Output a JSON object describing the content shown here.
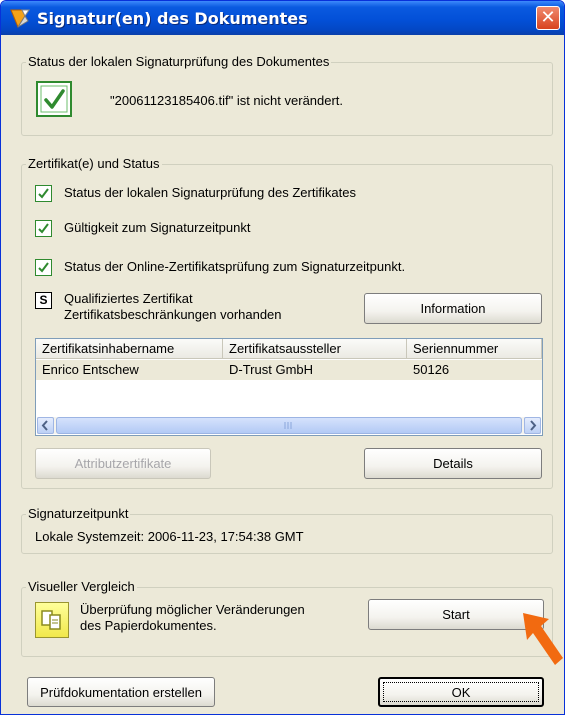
{
  "window": {
    "title": "Signatur(en) des Dokumentes",
    "close_glyph": "✕"
  },
  "doc_status": {
    "legend": "Status der lokalen Signaturprüfung des Dokumentes",
    "message": "\"20061123185406.tif\" ist nicht verändert.",
    "icon": "check-icon",
    "status_color": "#2f8a2f"
  },
  "cert": {
    "legend": "Zertifikat(e) und Status",
    "checks": [
      "Status der lokalen Signaturprüfung des Zertifikates",
      "Gültigkeit zum Signaturzeitpunkt",
      "Status der Online-Zertifikatsprüfung zum Signaturzeitpunkt."
    ],
    "qualified_badge": "S",
    "qualified_line1": "Qualifiziertes Zertifikat",
    "qualified_line2": "Zertifikatsbeschränkungen vorhanden",
    "info_button": "Information",
    "table": {
      "columns": [
        "Zertifikatsinhabername",
        "Zertifikatsaussteller",
        "Seriennummer"
      ],
      "rows": [
        [
          "Enrico Entschew",
          "D-Trust GmbH",
          "50126"
        ]
      ]
    },
    "attr_button": "Attributzertifikate",
    "details_button": "Details"
  },
  "sig_time": {
    "legend": "Signaturzeitpunkt",
    "text": "Lokale Systemzeit: 2006-11-23, 17:54:38 GMT"
  },
  "visual": {
    "legend": "Visueller Vergleich",
    "line1": "Überprüfung möglicher Veränderungen",
    "line2": "des Papierdokumentes.",
    "start_button": "Start",
    "arrow_color": "#f26a10"
  },
  "footer": {
    "report_button": "Prüfdokumentation erstellen",
    "ok_button": "OK"
  },
  "colors": {
    "title_bar": "#0350d8",
    "dialog_bg": "#ece9d8",
    "selection_row": "#ece9d8",
    "check_green": "#2f8a2f"
  }
}
